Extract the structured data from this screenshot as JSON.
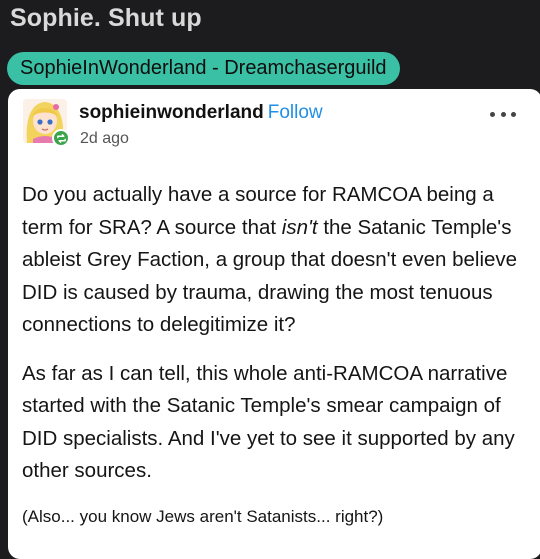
{
  "header": {
    "title": "Sophie. Shut up"
  },
  "tag_chip": {
    "label": "SophieInWonderland - Dreamchaserguild"
  },
  "post": {
    "username": "sophieinwonderland",
    "follow_label": "Follow",
    "timestamp": "2d ago",
    "avatar_icon": "anime-girl-avatar",
    "badge_icon": "reblog-icon",
    "menu_icon": "more-options-icon",
    "paragraph1_before": "Do you actually have a source for RAMCOA being a term for SRA? A source that ",
    "paragraph1_em": "isn't",
    "paragraph1_after": " the Satanic Temple's ableist Grey Faction, a group that doesn't even believe DID is caused by trauma, drawing the most tenuous connections to delegitimize it?",
    "paragraph2": "As far as I can tell, this whole anti-RAMCOA narrative started with the Satanic Temple's smear campaign of DID specialists. And I've yet to see it supported by any other sources.",
    "paragraph3": "(Also... you know Jews aren't Satanists... right?)"
  },
  "colors": {
    "background": "#1c1c1e",
    "chip": "#3ac0a4",
    "follow_link": "#1f8fe8",
    "badge": "#3ca54c"
  }
}
